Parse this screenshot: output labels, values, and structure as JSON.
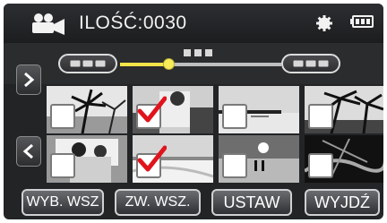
{
  "header": {
    "mode_icon": "video-camera-icon",
    "count_label": "ILOŚĆ:0030",
    "settings_icon": "gear-icon",
    "battery_icon": "battery-icon"
  },
  "scrubber": {
    "position_fraction": 0.3
  },
  "thumbnails": [
    {
      "checked": false
    },
    {
      "checked": true
    },
    {
      "checked": false
    },
    {
      "checked": false
    },
    {
      "checked": false
    },
    {
      "checked": true
    },
    {
      "checked": false
    },
    {
      "checked": false
    }
  ],
  "buttons": {
    "select_all": "WYB. WSZ",
    "clear_all": "ZW. WSZ.",
    "set": "USTAW",
    "exit": "WYJDŹ"
  },
  "colors": {
    "accent_yellow": "#f3e44a",
    "checkmark_red": "#e0141c",
    "background": "#222426"
  }
}
